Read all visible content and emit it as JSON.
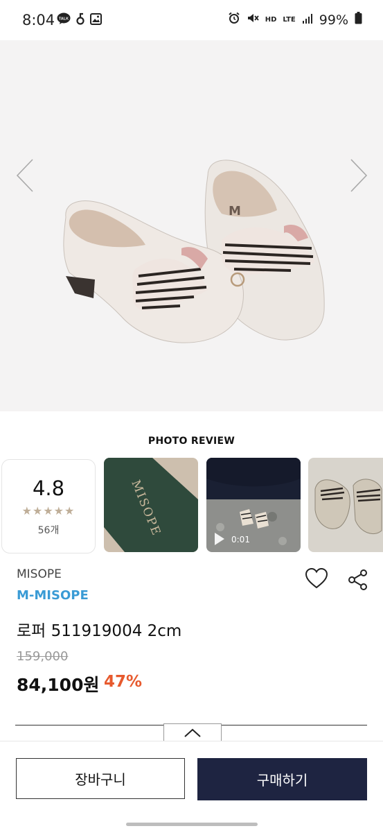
{
  "status_bar": {
    "time": "8:04",
    "left_icons": [
      "kakaotalk-icon",
      "notification-icon",
      "gallery-icon"
    ],
    "right_icons": [
      "alarm-icon",
      "mute-icon",
      "hd-voice-icon",
      "lte-icon",
      "signal-icon",
      "battery-icon"
    ],
    "hd_label": "HD",
    "lte_label": "LTE",
    "battery_percent": "99%"
  },
  "hero": {
    "image_icon": "loafers-product-image",
    "prev_icon": "chevron-left-icon",
    "next_icon": "chevron-right-icon",
    "brand_mark": "M"
  },
  "photo_review": {
    "title": "PHOTO REVIEW",
    "rating": "4.8",
    "stars": "★★★★★",
    "count": "56개",
    "thumbnails": [
      {
        "icon": "shoe-box-photo",
        "text": "MISOPE"
      },
      {
        "icon": "video-thumbnail-photo",
        "duration": "0:01"
      },
      {
        "icon": "shoes-photo"
      }
    ]
  },
  "product": {
    "brand": "MISOPE",
    "store": "M-MISOPE",
    "name": "로퍼 511919004 2cm",
    "original_price": "159,000",
    "sale_price": "84,100원",
    "discount": "47%"
  },
  "actions": {
    "cart_label": "장바구니",
    "buy_label": "구매하기"
  },
  "colors": {
    "store_link": "#3a9bd5",
    "discount": "#e75a2e",
    "buy_button": "#1e2441",
    "stars": "#bfae98"
  }
}
